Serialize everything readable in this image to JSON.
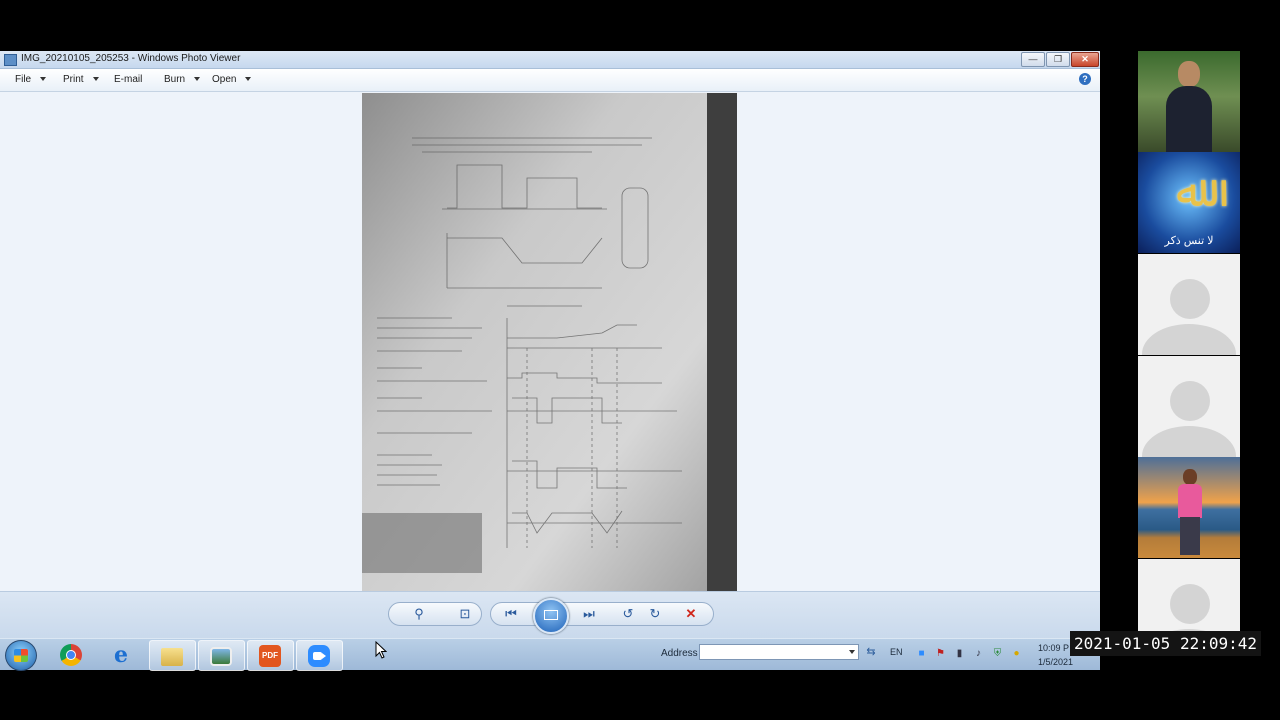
{
  "window": {
    "title": "IMG_20210105_205253 - Windows Photo Viewer",
    "buttons": {
      "minimize": "—",
      "maximize": "❐",
      "close": "✕"
    }
  },
  "menu": {
    "items": [
      {
        "label": "File",
        "has_dropdown": true
      },
      {
        "label": "Print",
        "has_dropdown": true
      },
      {
        "label": "E-mail",
        "has_dropdown": false
      },
      {
        "label": "Burn",
        "has_dropdown": true
      },
      {
        "label": "Open",
        "has_dropdown": true
      }
    ],
    "help": "?"
  },
  "viewer_toolbar": {
    "icons": [
      "zoom-icon",
      "actual-size-icon",
      "previous-icon",
      "slideshow-icon",
      "next-icon",
      "rotate-counterclockwise-icon",
      "rotate-clockwise-icon",
      "delete-icon"
    ]
  },
  "taskbar": {
    "apps": [
      "windows-start",
      "chrome",
      "internet-explorer",
      "windows-explorer",
      "windows-photo-viewer",
      "pdf-reader",
      "zoom"
    ],
    "address_label": "Address",
    "address_value": "",
    "language": "EN",
    "clock_time": "10:09 P",
    "clock_date": "1/5/2021"
  },
  "timestamp_overlay": "2021-01-05  22:09:42",
  "participants": [
    {
      "kind": "video"
    },
    {
      "kind": "image",
      "caption": "لا تنس ذكر"
    },
    {
      "kind": "placeholder"
    },
    {
      "kind": "placeholder"
    },
    {
      "kind": "video"
    },
    {
      "kind": "placeholder"
    }
  ],
  "colors": {
    "window_bg": "#eef3fa",
    "taskbar": "#a9c2de",
    "accent": "#1e62b8"
  }
}
